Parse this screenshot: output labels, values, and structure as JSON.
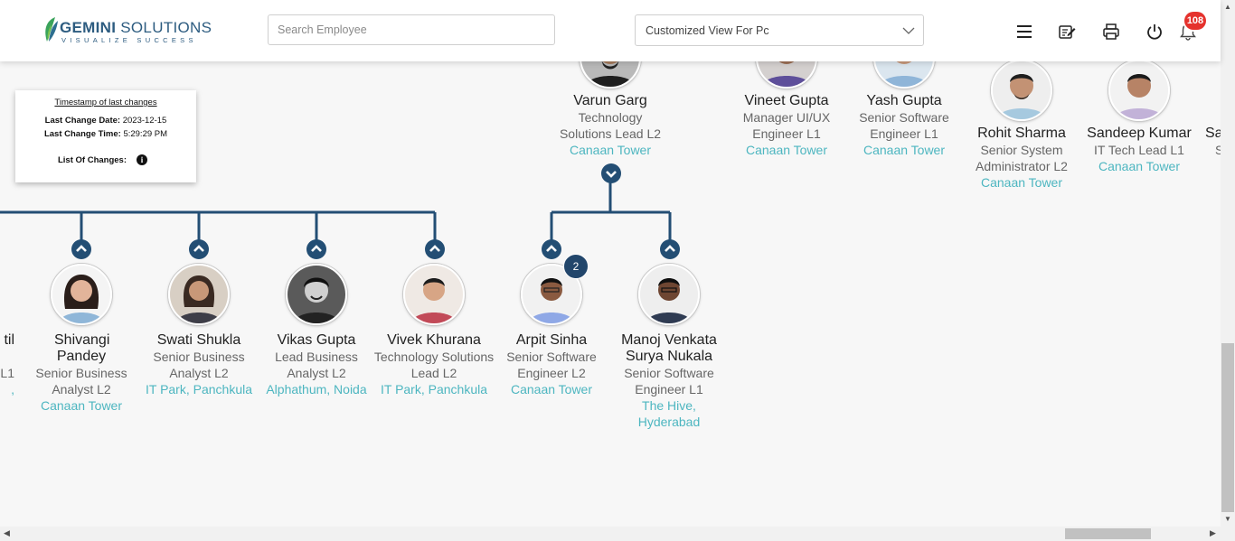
{
  "header": {
    "logo_brand_bold": "GEMINI",
    "logo_brand_rest": " SOLUTIONS",
    "logo_tagline": "VISUALIZE SUCCESS",
    "search_placeholder": "Search Employee",
    "view_selected": "Customized View For Pc",
    "notification_count": "108"
  },
  "timestamp_card": {
    "title": "Timestamp of last changes",
    "date_label": "Last Change Date:",
    "date_value": "2023-12-15",
    "time_label": "Last Change Time:",
    "time_value": "5:29:29 PM",
    "changes_label": "List Of Changes:"
  },
  "top_row": [
    {
      "name": "Varun Garg",
      "title": "Technology Solutions Lead L2",
      "location": "Canaan Tower"
    },
    {
      "name": "Vineet Gupta",
      "title": "Manager UI/UX Engineer L1",
      "location": "Canaan Tower"
    },
    {
      "name": "Yash Gupta",
      "title": "Senior Software Engineer L1",
      "location": "Canaan Tower"
    },
    {
      "name": "Rohit Sharma",
      "title": "Senior System Administrator L2",
      "location": "Canaan Tower"
    },
    {
      "name": "Sandeep Kumar",
      "title": "IT Tech Lead L1",
      "location": "Canaan Tower"
    },
    {
      "name": "Sa",
      "title": "S",
      "location": ""
    }
  ],
  "bottom_row": [
    {
      "name": "til",
      "title": "L1",
      "location": ","
    },
    {
      "name": "Shivangi Pandey",
      "title": "Senior Business Analyst L2",
      "location": "Canaan Tower"
    },
    {
      "name": "Swati Shukla",
      "title": "Senior Business Analyst L2",
      "location": "IT Park, Panchkula"
    },
    {
      "name": "Vikas Gupta",
      "title": "Lead Business Analyst L2",
      "location": "Alphathum, Noida"
    },
    {
      "name": "Vivek Khurana",
      "title": "Technology Solutions Lead L2",
      "location": "IT Park, Panchkula"
    },
    {
      "name": "Arpit Sinha",
      "title": "Senior Software Engineer L2",
      "location": "Canaan Tower",
      "reports": "2"
    },
    {
      "name": "Manoj Venkata Surya Nukala",
      "title": "Senior Software Engineer L1",
      "location": "The Hive, Hyderabad"
    }
  ]
}
